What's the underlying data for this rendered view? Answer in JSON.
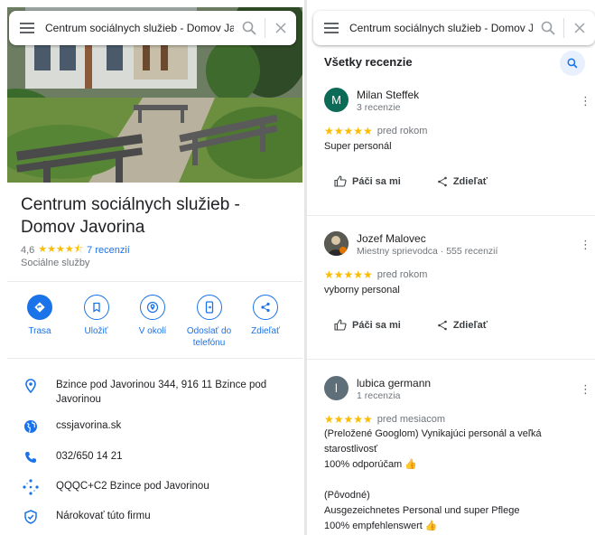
{
  "left": {
    "search_text": "Centrum sociálnych služieb - Domov Javorina",
    "place": {
      "title_line1": "Centrum sociálnych služieb -",
      "title_line2": "Domov Javorina",
      "rating": "4,6",
      "stars": "★★★★⯪",
      "reviews_link": "7 recenzií",
      "category": "Sociálne služby"
    },
    "actions": [
      {
        "label": "Trasa",
        "icon": "directions-icon"
      },
      {
        "label": "Uložiť",
        "icon": "bookmark-icon"
      },
      {
        "label": "V okolí",
        "icon": "nearby-icon"
      },
      {
        "label_line1": "Odoslať do",
        "label_line2": "telefónu",
        "icon": "send-to-phone-icon"
      },
      {
        "label": "Zdieľať",
        "icon": "share-icon"
      }
    ],
    "info": {
      "address_line1": "Bzince pod Javorinou 344, 916 11 Bzince pod",
      "address_line2": "Javorinou",
      "website": "cssjavorina.sk",
      "phone": "032/650 14 21",
      "plus_code": "QQQC+C2 Bzince pod Javorinou",
      "claim": "Nárokovať túto firmu"
    }
  },
  "right": {
    "search_text": "Centrum sociálnych služieb - Domov Javorina",
    "header": "Všetky recenzie",
    "reviews": [
      {
        "initial": "M",
        "avatar_color": "#0b6b57",
        "name": "Milan Steffek",
        "sub": "3 recenzie",
        "stars": "★★★★★",
        "date": "pred rokom",
        "lines": [
          "Super personál"
        ]
      },
      {
        "initial": "",
        "avatar_color": "#3c4043",
        "name": "Jozef Malovec",
        "sub": "Miestny sprievodca · 555 recenzií",
        "stars": "★★★★★",
        "date": "pred rokom",
        "lines": [
          "vyborny personal"
        ]
      },
      {
        "initial": "l",
        "avatar_color": "#5f6f7a",
        "name": "lubica germann",
        "sub": "1 recenzia",
        "stars": "★★★★★",
        "date": "pred mesiacom",
        "lines": [
          "(Preložené Googlom) Vynikajúci personál a veľká",
          "starostlivosť",
          "100% odporúčam 👍",
          "",
          "(Pôvodné)",
          "Ausgezeichnetes Personal und super Pflege",
          "100% empfehlenswert 👍"
        ]
      }
    ],
    "like_label": "Páči sa mi",
    "share_label": "Zdieľať"
  },
  "colors": {
    "accent": "#1a73e8",
    "star": "#fbbc04"
  }
}
